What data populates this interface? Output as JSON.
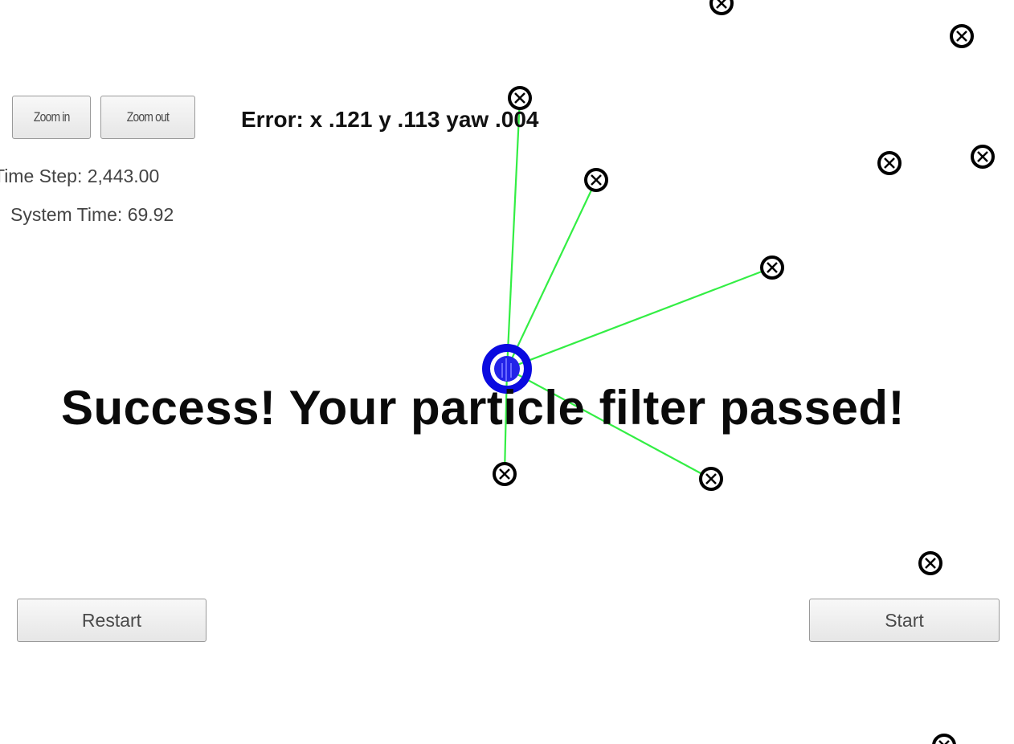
{
  "toolbar": {
    "zoom_in_label": "Zoom in",
    "zoom_out_label": "Zoom out"
  },
  "stats": {
    "time_step": "Time Step: 2,443.00",
    "system_time": "System Time: 69.92"
  },
  "error_readout": "Error: x .121 y .113 yaw .004",
  "status_message": "Success! Your particle filter passed!",
  "controls": {
    "restart_label": "Restart",
    "start_label": "Start"
  },
  "colors": {
    "observation_line": "#33ee44",
    "vehicle": "#0a0ae0",
    "landmark": "#000000"
  },
  "icons": {
    "landmark": "landmark-marker-icon",
    "vehicle": "vehicle-icon"
  }
}
